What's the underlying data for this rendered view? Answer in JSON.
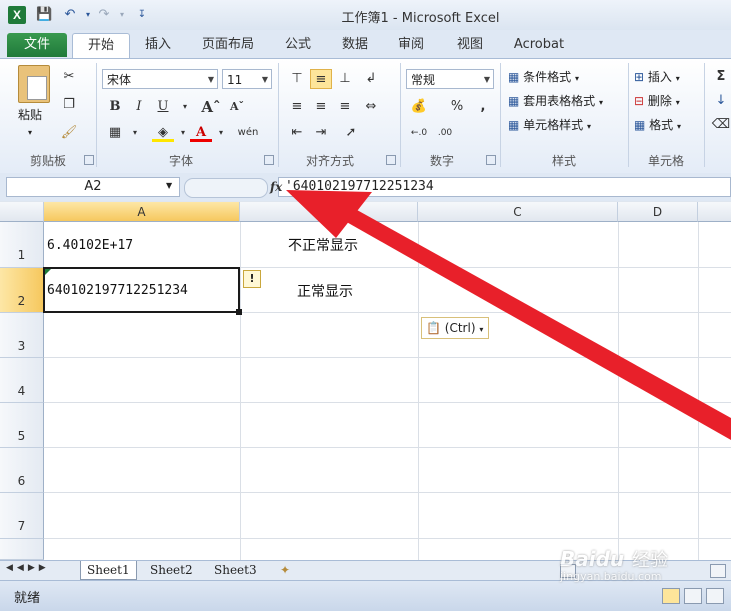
{
  "window": {
    "title": "工作簿1 - Microsoft Excel",
    "app_icon_glyph": "X"
  },
  "quick_access": {
    "save_icon": "save-icon",
    "undo_icon": "undo-icon",
    "redo_icon": "redo-icon",
    "customize_icon": "customize-qat-icon"
  },
  "tabs": [
    {
      "label": "文件"
    },
    {
      "label": "开始"
    },
    {
      "label": "插入"
    },
    {
      "label": "页面布局"
    },
    {
      "label": "公式"
    },
    {
      "label": "数据"
    },
    {
      "label": "审阅"
    },
    {
      "label": "视图"
    },
    {
      "label": "Acrobat"
    }
  ],
  "ribbon": {
    "clipboard": {
      "label": "剪贴板",
      "paste_label": "粘贴"
    },
    "font": {
      "label": "字体",
      "font_name": "宋体",
      "font_size": "11",
      "wen_label": "wén"
    },
    "alignment": {
      "label": "对齐方式"
    },
    "number": {
      "label": "数字",
      "format": "常规",
      "percent": "%",
      "comma": ","
    },
    "styles": {
      "label": "样式",
      "conditional_format": "条件格式",
      "table_format": "套用表格格式",
      "cell_styles": "单元格样式"
    },
    "cells": {
      "label": "单元格",
      "insert": "插入",
      "delete": "删除",
      "format": "格式"
    }
  },
  "formula_bar": {
    "name_box": "A2",
    "fx_label": "fx",
    "formula": "'640102197712251234"
  },
  "grid": {
    "columns": [
      "A",
      "B",
      "C",
      "D"
    ],
    "rows": [
      "1",
      "2",
      "3",
      "4",
      "5",
      "6",
      "7"
    ],
    "cells": {
      "A1": "6.40102E+17",
      "B1": "不正常显示",
      "A2": "640102197712251234",
      "B2": "正常显示"
    },
    "paste_options_label": "(Ctrl)",
    "error_indicator": "!"
  },
  "sheets": [
    "Sheet1",
    "Sheet2",
    "Sheet3"
  ],
  "status": {
    "text": "就绪"
  },
  "watermark": {
    "brand": "Baidu",
    "cn": "经验",
    "url": "jingyan.baidu.com"
  },
  "colors": {
    "accent_green": "#1f7a3a",
    "arrow_red": "#e8202a",
    "selection_border": "#1a1a1a"
  }
}
